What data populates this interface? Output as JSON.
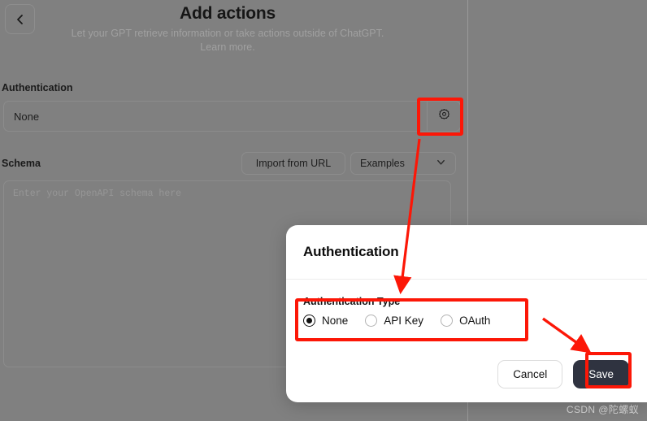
{
  "background_page": {
    "back_button_icon": "chevron-left-icon",
    "title": "Add actions",
    "subtitle_line1": "Let your GPT retrieve information or take actions outside of ChatGPT.",
    "subtitle_line2": "Learn more.",
    "authentication": {
      "label": "Authentication",
      "value": "None",
      "settings_icon": "gear-icon"
    },
    "schema": {
      "label": "Schema",
      "import_button": "Import from URL",
      "examples_button": "Examples",
      "examples_chevron_icon": "chevron-down-icon",
      "placeholder": "Enter your OpenAPI schema here"
    }
  },
  "modal": {
    "title": "Authentication",
    "auth_type_label": "Authentication Type",
    "options": [
      {
        "label": "None",
        "selected": true
      },
      {
        "label": "API Key",
        "selected": false
      },
      {
        "label": "OAuth",
        "selected": false
      }
    ],
    "cancel_label": "Cancel",
    "save_label": "Save"
  },
  "annotations": {
    "highlight_color": "#fc1707",
    "boxes": [
      "gear-settings-button",
      "authentication-type-group",
      "save-button"
    ],
    "arrows": [
      "gear-button-to-modal-body",
      "pointer-to-save-button"
    ]
  },
  "watermark": "CSDN @陀螺蚁"
}
